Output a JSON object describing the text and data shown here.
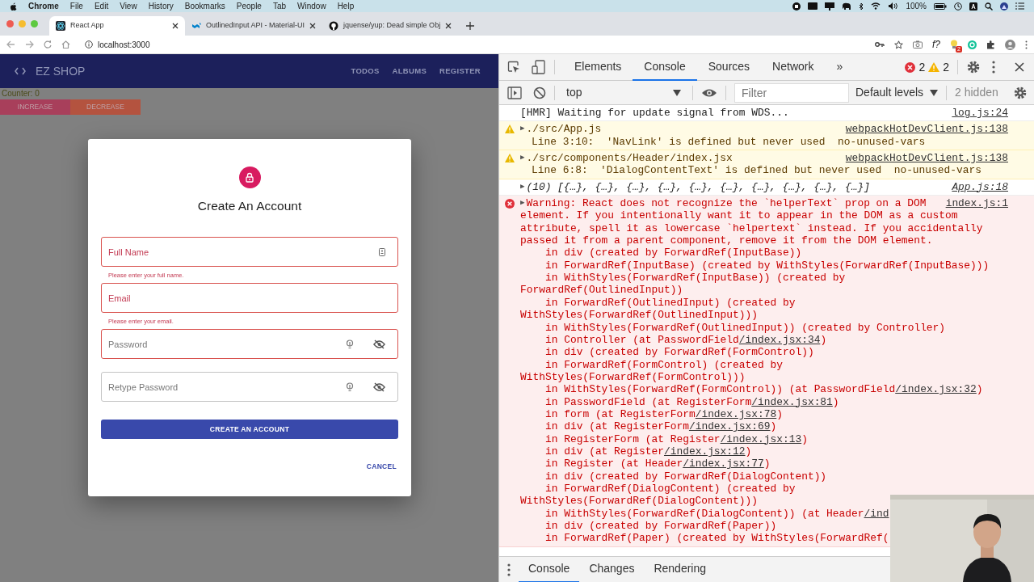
{
  "menubar": {
    "app": "Chrome",
    "items": [
      "File",
      "Edit",
      "View",
      "History",
      "Bookmarks",
      "People",
      "Tab",
      "Window",
      "Help"
    ],
    "battery": "100%"
  },
  "browser": {
    "tabs": [
      {
        "title": "React App",
        "selected": true,
        "kind": "react"
      },
      {
        "title": "OutlinedInput API - Material-UI",
        "selected": false,
        "kind": "mui"
      },
      {
        "title": "jquense/yup: Dead simple Obj",
        "selected": false,
        "kind": "github"
      }
    ],
    "url": "localhost:3000",
    "extension_label": "f?",
    "extension_badge": "2"
  },
  "app": {
    "brand": "EZ SHOP",
    "nav": [
      "TODOS",
      "ALBUMS",
      "REGISTER"
    ],
    "counter": "Counter: 0",
    "buttons": [
      "INCREASE",
      "DECREASE"
    ]
  },
  "dialog": {
    "title": "Create An Account",
    "fields": [
      {
        "kind": "name",
        "placeholder": "Full Name",
        "error": true,
        "label_error": true,
        "helper": "Please enter your full name."
      },
      {
        "kind": "email",
        "placeholder": "Email",
        "error": true,
        "label_error": true,
        "helper": "Please enter your email."
      },
      {
        "kind": "password",
        "placeholder": "Password",
        "error": true,
        "label_error": false
      },
      {
        "kind": "password",
        "placeholder": "Retype Password",
        "error": false,
        "label_error": false
      }
    ],
    "submit": "CREATE AN ACCOUNT",
    "cancel": "CANCEL"
  },
  "devtools": {
    "tabs": [
      {
        "label": "Elements",
        "selected": false
      },
      {
        "label": "Console",
        "selected": true
      },
      {
        "label": "Sources",
        "selected": false
      },
      {
        "label": "Network",
        "selected": false
      }
    ],
    "more": "»",
    "errors": "2",
    "warnings": "2",
    "context": "top",
    "filter_placeholder": "Filter",
    "levels": "Default levels",
    "hidden": "2 hidden",
    "messages": [
      {
        "kind": "log",
        "source": "log.js:24",
        "lines": [
          {
            "text": "[HMR] Waiting for update signal from WDS...",
            "indented": false
          }
        ]
      },
      {
        "kind": "warning",
        "toggle": "▶",
        "source": "webpackHotDevClient.js:138",
        "lines": [
          {
            "text": "./src/App.js",
            "indented": false
          },
          {
            "text": "Line 3:10:  'NavLink' is defined but never used  no-unused-vars",
            "indented": false
          }
        ]
      },
      {
        "kind": "warning",
        "toggle": "▶",
        "source": "webpackHotDevClient.js:138",
        "lines": [
          {
            "text": "./src/components/Header/index.jsx",
            "indented": false
          },
          {
            "text": "Line 6:8:  'DialogContentText' is defined but never used  no-unused-vars",
            "indented": false
          }
        ]
      },
      {
        "kind": "object",
        "toggle": "▶",
        "source": "App.js:18",
        "lines": [
          {
            "text": "(10) [{…}, {…}, {…}, {…}, {…}, {…}, {…}, {…}, {…}, {…}]",
            "indented": false
          }
        ]
      },
      {
        "kind": "error",
        "toggle": "▶",
        "source": "index.js:1",
        "lines": [
          {
            "text": "Warning: React does not recognize the `helperText` prop on a DOM",
            "indented": false
          },
          {
            "text": "element. If you intentionally want it to appear in the DOM as a custom",
            "indented": false
          },
          {
            "text": "attribute, spell it as lowercase `helpertext` instead. If you accidentally",
            "indented": false
          },
          {
            "text": "passed it from a parent component, remove it from the DOM element.",
            "indented": false
          },
          {
            "text": "in div (created by ForwardRef(InputBase))",
            "indented": true
          },
          {
            "text": "in ForwardRef(InputBase) (created by WithStyles(ForwardRef(InputBase)))",
            "indented": true
          },
          {
            "text": "in WithStyles(ForwardRef(InputBase)) (created by",
            "indented": true
          },
          {
            "text": "ForwardRef(OutlinedInput))",
            "indented": false
          },
          {
            "text": "in ForwardRef(OutlinedInput) (created by",
            "indented": true
          },
          {
            "text": "WithStyles(ForwardRef(OutlinedInput)))",
            "indented": false
          },
          {
            "text": "in WithStyles(ForwardRef(OutlinedInput)) (created by Controller)",
            "indented": true
          },
          {
            "text": "in Controller (at PasswordField",
            "link": "/index.jsx:34",
            "tail": ")",
            "indented": true
          },
          {
            "text": "in div (created by ForwardRef(FormControl))",
            "indented": true
          },
          {
            "text": "in ForwardRef(FormControl) (created by",
            "indented": true
          },
          {
            "text": "WithStyles(ForwardRef(FormControl)))",
            "indented": false
          },
          {
            "text": "in WithStyles(ForwardRef(FormControl)) (at PasswordField",
            "link": "/index.jsx:32",
            "tail": ")",
            "indented": true
          },
          {
            "text": "in PasswordField (at RegisterForm",
            "link": "/index.jsx:81",
            "tail": ")",
            "indented": true
          },
          {
            "text": "in form (at RegisterForm",
            "link": "/index.jsx:78",
            "tail": ")",
            "indented": true
          },
          {
            "text": "in div (at RegisterForm",
            "link": "/index.jsx:69",
            "tail": ")",
            "indented": true
          },
          {
            "text": "in RegisterForm (at Register",
            "link": "/index.jsx:13",
            "tail": ")",
            "indented": true
          },
          {
            "text": "in div (at Register",
            "link": "/index.jsx:12",
            "tail": ")",
            "indented": true
          },
          {
            "text": "in Register (at Header",
            "link": "/index.jsx:77",
            "tail": ")",
            "indented": true
          },
          {
            "text": "in div (created by ForwardRef(DialogContent))",
            "indented": true
          },
          {
            "text": "in ForwardRef(DialogContent) (created by",
            "indented": true
          },
          {
            "text": "WithStyles(ForwardRef(DialogContent)))",
            "indented": false
          },
          {
            "text": "in WithStyles(ForwardRef(DialogContent)) (at Header",
            "link": "/ind",
            "indented": true
          },
          {
            "text": "in div (created by ForwardRef(Paper))",
            "indented": true
          },
          {
            "text": "in ForwardRef(Paper) (created by WithStyles(ForwardRef(",
            "indented": true
          }
        ]
      }
    ],
    "drawer_tabs": [
      {
        "label": "Console",
        "selected": true
      },
      {
        "label": "Changes",
        "selected": false
      },
      {
        "label": "Rendering",
        "selected": false
      }
    ]
  }
}
